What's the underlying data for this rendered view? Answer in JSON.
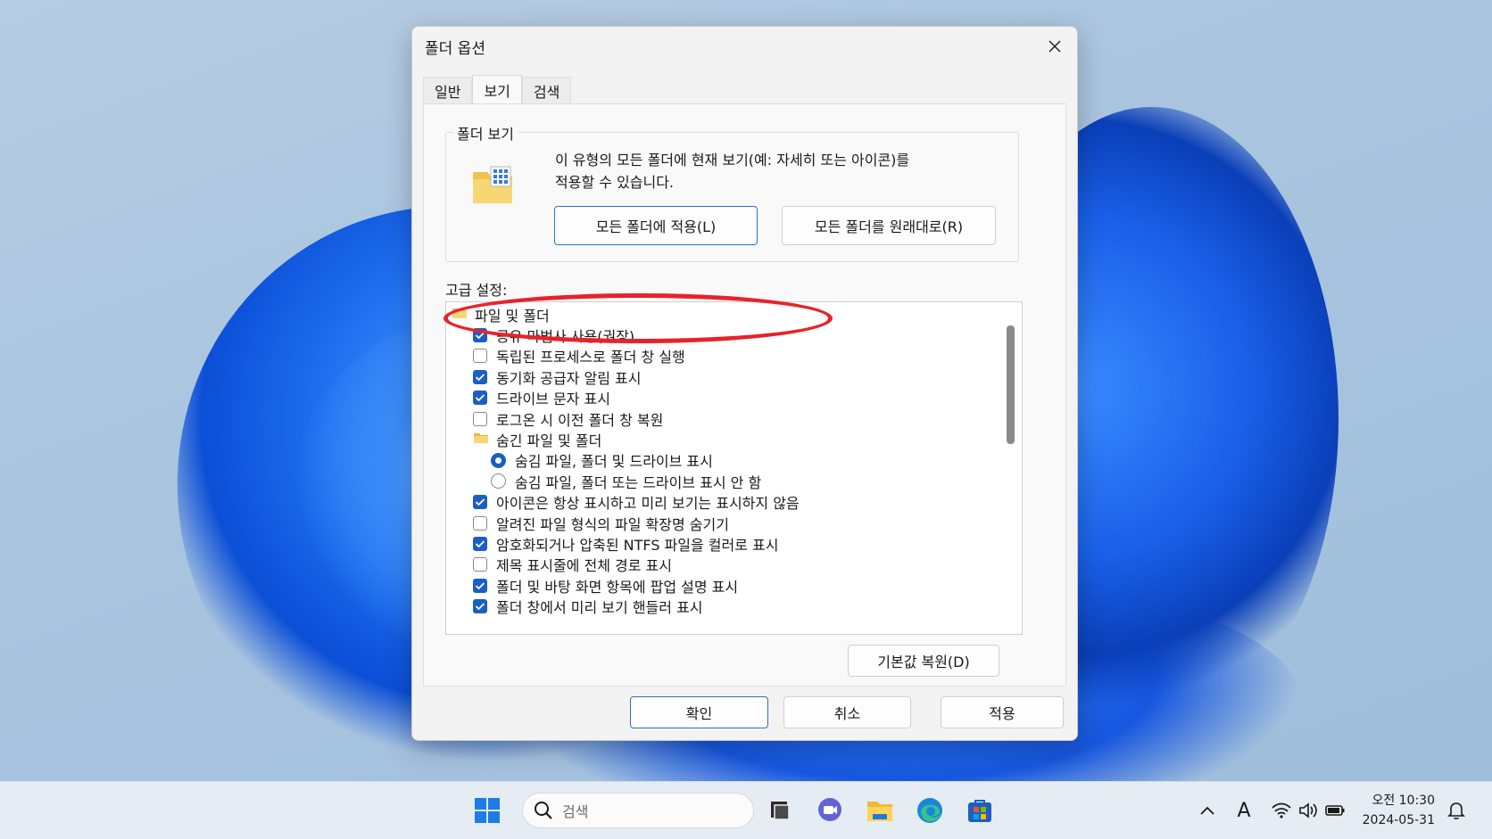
{
  "dialog": {
    "title": "폴더 옵션",
    "tabs": [
      {
        "label": "일반",
        "active": false
      },
      {
        "label": "보기",
        "active": true
      },
      {
        "label": "검색",
        "active": false
      }
    ],
    "folder_views": {
      "legend": "폴더 보기",
      "desc_line1": "이 유형의 모든 폴더에 현재 보기(예: 자세히 또는 아이콘)를",
      "desc_line2": "적용할 수 있습니다.",
      "apply_all_label": "모든 폴더에 적용(L)",
      "reset_all_label": "모든 폴더를 원래대로(R)"
    },
    "advanced": {
      "label": "고급 설정:",
      "items": [
        {
          "type": "folder",
          "indent": 0,
          "label": "파일 및 폴더"
        },
        {
          "type": "check",
          "indent": 1,
          "checked": true,
          "label": "공유 마법사 사용(권장)"
        },
        {
          "type": "check",
          "indent": 1,
          "checked": false,
          "label": "독립된 프로세스로 폴더 창 실행"
        },
        {
          "type": "check",
          "indent": 1,
          "checked": true,
          "label": "동기화 공급자 알림 표시"
        },
        {
          "type": "check",
          "indent": 1,
          "checked": true,
          "label": "드라이브 문자 표시"
        },
        {
          "type": "check",
          "indent": 1,
          "checked": false,
          "label": "로그온 시 이전 폴더 창 복원"
        },
        {
          "type": "folder",
          "indent": 1,
          "label": "숨긴 파일 및 폴더"
        },
        {
          "type": "radio",
          "indent": 2,
          "checked": true,
          "label": "숨김 파일, 폴더 및 드라이브 표시"
        },
        {
          "type": "radio",
          "indent": 2,
          "checked": false,
          "label": "숨김 파일, 폴더 또는 드라이브 표시 안 함"
        },
        {
          "type": "check",
          "indent": 1,
          "checked": true,
          "label": "아이콘은 항상 표시하고 미리 보기는 표시하지 않음"
        },
        {
          "type": "check",
          "indent": 1,
          "checked": false,
          "label": "알려진 파일 형식의 파일 확장명 숨기기"
        },
        {
          "type": "check",
          "indent": 1,
          "checked": true,
          "label": "암호화되거나 압축된 NTFS 파일을 컬러로 표시"
        },
        {
          "type": "check",
          "indent": 1,
          "checked": false,
          "label": "제목 표시줄에 전체 경로 표시"
        },
        {
          "type": "check",
          "indent": 1,
          "checked": true,
          "label": "폴더 및 바탕 화면 항목에 팝업 설명 표시"
        },
        {
          "type": "check",
          "indent": 1,
          "checked": true,
          "label": "폴더 창에서 미리 보기 핸들러 표시"
        }
      ]
    },
    "restore_defaults_label": "기본값 복원(D)",
    "ok_label": "확인",
    "cancel_label": "취소",
    "apply_label": "적용"
  },
  "annotation": {
    "color": "#e8222a",
    "target": "아이콘은 항상 표시하고 미리 보기는 표시하지 않음"
  },
  "taskbar": {
    "search_placeholder": "검색",
    "pinned_icons": [
      "start-icon",
      "task-view-icon",
      "chat-icon",
      "file-explorer-icon",
      "edge-icon",
      "store-icon"
    ],
    "tray_icons": [
      "chevron-up-icon",
      "ime-icon",
      "wifi-icon",
      "volume-icon",
      "battery-icon"
    ],
    "ime_label": "A",
    "time": "오전 10:30",
    "date": "2024-05-31"
  },
  "colors": {
    "accent": "#1a5fc4",
    "annotation": "#e8222a"
  }
}
